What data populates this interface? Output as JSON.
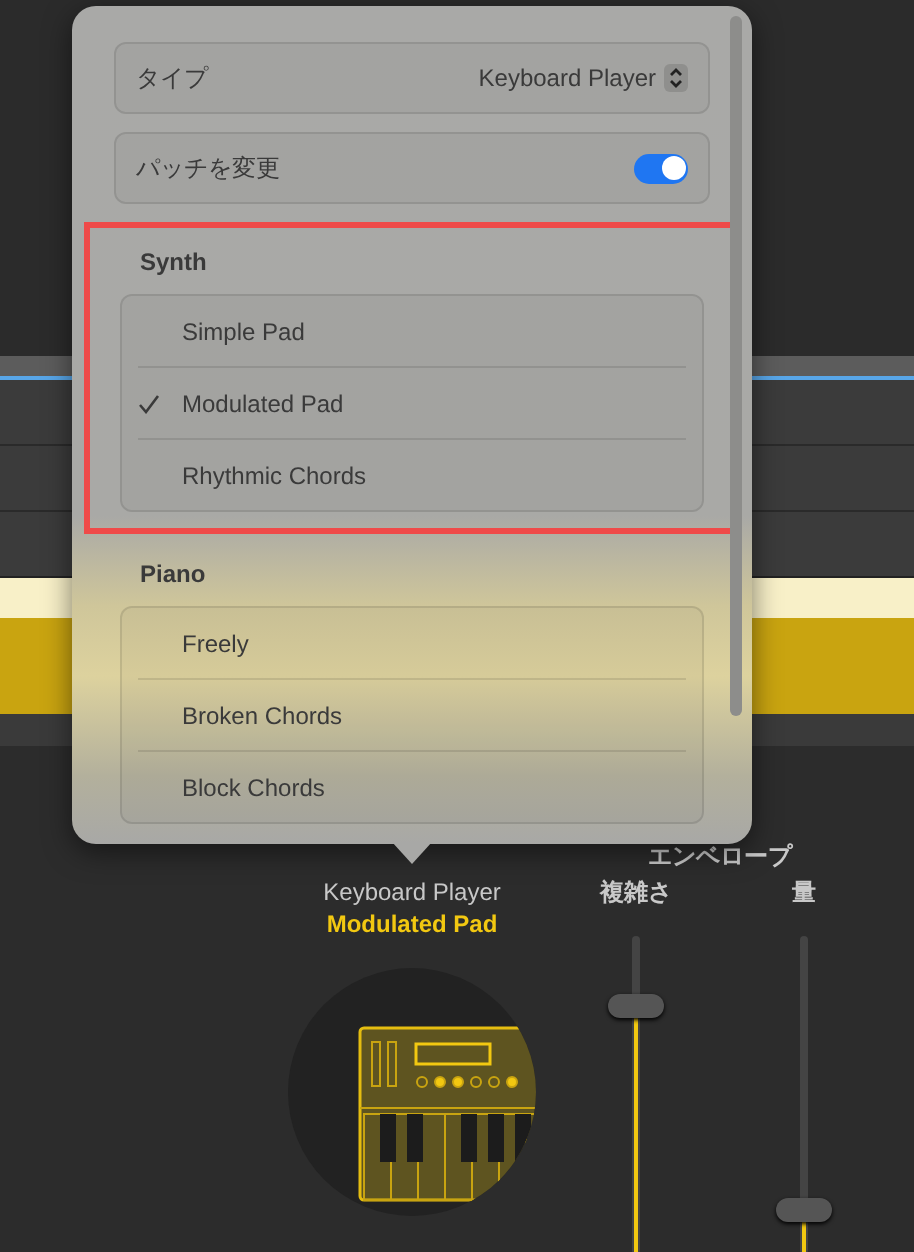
{
  "popover": {
    "settings": [
      {
        "kind": "select",
        "label": "タイプ",
        "value": "Keyboard Player"
      },
      {
        "kind": "toggle",
        "label": "パッチを変更",
        "on": true
      }
    ],
    "groups": [
      {
        "title": "Synth",
        "highlighted": true,
        "items": [
          {
            "label": "Simple Pad",
            "selected": false
          },
          {
            "label": "Modulated Pad",
            "selected": true
          },
          {
            "label": "Rhythmic Chords",
            "selected": false
          }
        ]
      },
      {
        "title": "Piano",
        "highlighted": false,
        "items": [
          {
            "label": "Freely",
            "selected": false
          },
          {
            "label": "Broken Chords",
            "selected": false
          },
          {
            "label": "Block Chords",
            "selected": false
          }
        ]
      }
    ]
  },
  "instrument": {
    "name": "Keyboard Player",
    "patch": "Modulated Pad"
  },
  "envelope": {
    "title": "エンベロープ",
    "sliders": [
      {
        "label": "複雑さ",
        "level": 0.78
      },
      {
        "label": "量",
        "level": 0.14
      }
    ]
  }
}
